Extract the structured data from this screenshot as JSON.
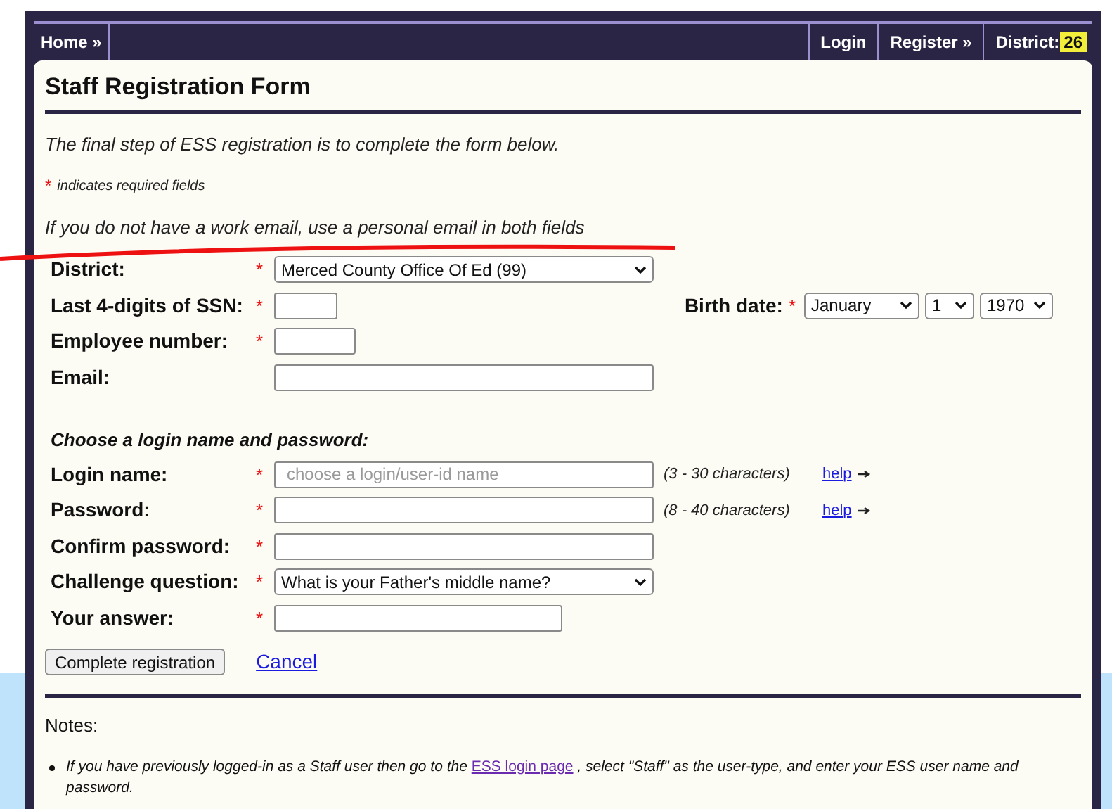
{
  "nav": {
    "left": [
      {
        "label": "Home »"
      }
    ],
    "right": [
      {
        "kind": "link",
        "label": "Login"
      },
      {
        "kind": "link",
        "label": "Register »"
      },
      {
        "kind": "badge",
        "label": "District:",
        "badge": "26"
      }
    ]
  },
  "title": "Staff Registration Form",
  "intro": "The final step of ESS registration is to complete the form below.",
  "required_note": {
    "mark": "*",
    "text": "indicates required fields"
  },
  "email_note": "If you do not have a work email, use a personal email in both fields",
  "fields": [
    {
      "label": "District:",
      "required": true,
      "kind": "select",
      "value": "Merced County Office Of Ed (99)"
    },
    {
      "label": "Last 4-digits of SSN:",
      "required": true,
      "kind": "text",
      "extra": {
        "label": "Birth date:",
        "required": true,
        "selects": [
          {
            "value": "January"
          },
          {
            "value": "1"
          },
          {
            "value": "1970"
          }
        ]
      }
    },
    {
      "label": "Employee number:",
      "required": true,
      "kind": "text"
    },
    {
      "label": "Email:",
      "required": false,
      "kind": "text"
    }
  ],
  "login_heading": "Choose a login name and password:",
  "login_fields": [
    {
      "label": "Login name:",
      "required": true,
      "kind": "text",
      "placeholder": "choose a login/user-id name",
      "hint": "(3 - 30 characters)",
      "help": "help"
    },
    {
      "label": "Password:",
      "required": true,
      "kind": "text",
      "hint": "(8 - 40 characters)",
      "help": "help"
    },
    {
      "label": "Confirm password:",
      "required": true,
      "kind": "text"
    },
    {
      "label": "Challenge question:",
      "required": true,
      "kind": "select",
      "value": "What is your Father's middle name?"
    },
    {
      "label": "Your answer:",
      "required": true,
      "kind": "text"
    }
  ],
  "submit": "Complete registration",
  "cancel": "Cancel",
  "notes_heading": "Notes:",
  "notes": [
    {
      "before": "If you have previously logged-in as a Staff user then go to the",
      "link": "ESS login page",
      "after": ", select \"Staff\" as the user-type, and enter your ESS user name and password."
    }
  ]
}
